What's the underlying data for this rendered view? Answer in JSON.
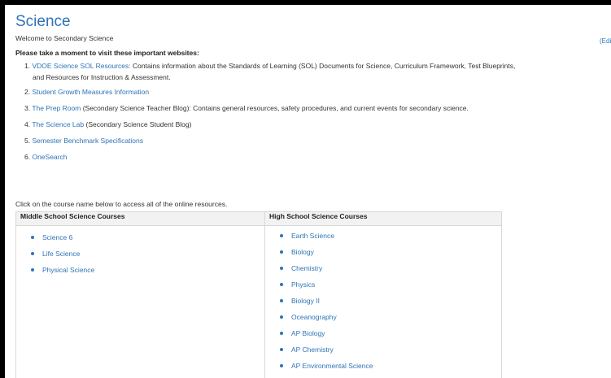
{
  "page": {
    "title": "Science",
    "edit_label": "(Edit",
    "welcome": "Welcome to Secondary Science",
    "websites_heading": "Please take a moment to visit these important websites:"
  },
  "websites": [
    {
      "num": "1.",
      "link": "VDOE Science SOL Resources:",
      "desc": " Contains information about the Standards of Learning (SOL) Documents for Science, Curriculum Framework, Test Blueprints,",
      "desc2": "and Resources for Instruction & Assessment."
    },
    {
      "num": "2.",
      "link": "Student Growth Measures Information",
      "desc": ""
    },
    {
      "num": "3.",
      "link": "The Prep Room",
      "desc": " (Secondary Science Teacher Blog):  Contains general resources, safety procedures, and current events for secondary science."
    },
    {
      "num": "4.",
      "link": "The Science Lab",
      "desc": " (Secondary Science Student Blog)"
    },
    {
      "num": "5.",
      "link": "Semester Benchmark Specifications",
      "desc": ""
    },
    {
      "num": "6.",
      "link": "OneSearch",
      "desc": ""
    }
  ],
  "courses_intro": "Click on the course name below to access all of the online resources.",
  "middle_school": {
    "heading": "Middle School Science Courses",
    "items": [
      "Science 6",
      "Life Science",
      "Physical Science"
    ]
  },
  "high_school": {
    "heading": "High School Science Courses",
    "items": [
      "Earth Science",
      "Biology",
      "Chemistry",
      "Physics",
      "Biology II",
      "Oceanography",
      "AP Biology",
      "AP Chemistry",
      "AP Environmental Science"
    ]
  },
  "colors": {
    "link": "#2e74b5",
    "frame": "#000000"
  },
  "icons": {
    "list_bullet": "bullet-dot-icon"
  }
}
